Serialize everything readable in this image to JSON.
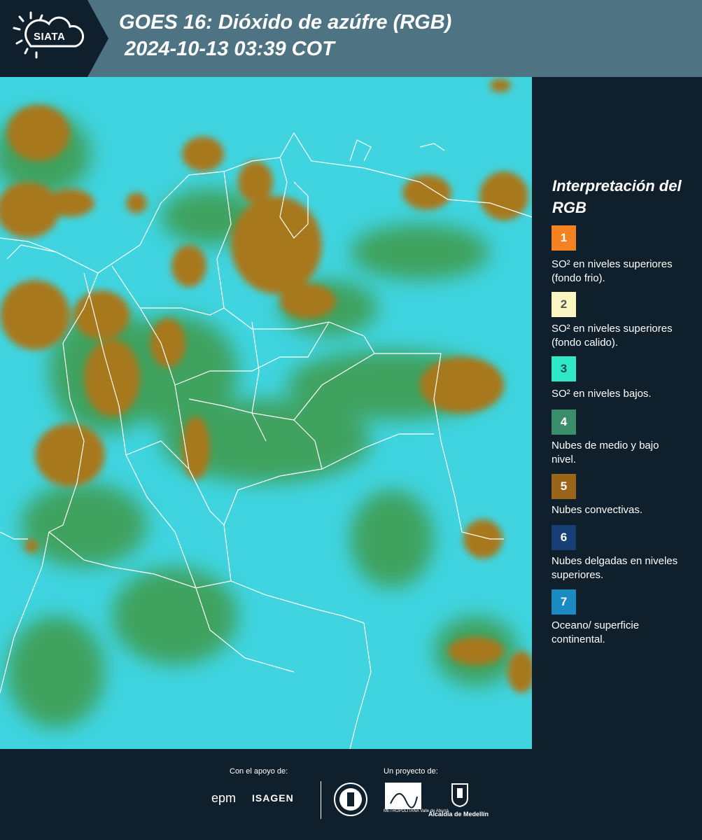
{
  "header": {
    "logo_text": "SIATA",
    "title_line1": "GOES 16: Dióxido de azúfre (RGB)",
    "title_line2": "2024-10-13 03:39 COT"
  },
  "legend": {
    "title": "Interpretación del RGB",
    "items": [
      {
        "number": "1",
        "label": "SO² en niveles superiores (fondo frio).",
        "color": "#f58220",
        "text_color": "#ffffff"
      },
      {
        "number": "2",
        "label": "SO² en niveles superiores (fondo calido).",
        "color": "#fdf6c3",
        "text_color": "#555555"
      },
      {
        "number": "3",
        "label": "SO² en niveles bajos.",
        "color": "#2ee8c8",
        "text_color": "#1a4a55"
      },
      {
        "number": "4",
        "label": "Nubes de medio y bajo nivel.",
        "color": "#3a8f6a",
        "text_color": "#ffffff"
      },
      {
        "number": "5",
        "label": "Nubes convectivas.",
        "color": "#9a6518",
        "text_color": "#ffffff"
      },
      {
        "number": "6",
        "label": "Nubes delgadas en niveles superiores.",
        "color": "#163f75",
        "text_color": "#ffffff"
      },
      {
        "number": "7",
        "label": "Oceano/ superficie continental.",
        "color": "#1a8ac0",
        "text_color": "#ffffff"
      }
    ]
  },
  "map": {
    "colors": {
      "background": "#3fd4e0",
      "cloud_green": "#3f9a48",
      "cloud_brown": "#a8781e",
      "border_lines": "#ffffff"
    }
  },
  "footer": {
    "support_label": "Con el apoyo de:",
    "project_label": "Un proyecto de:",
    "epm": "epm",
    "isagen": "ISAGEN",
    "area_logo": "Área",
    "area_sub": "METROPOLITANA Valle de Aburrá",
    "alcaldia": "Alcaldía de Medellín"
  }
}
